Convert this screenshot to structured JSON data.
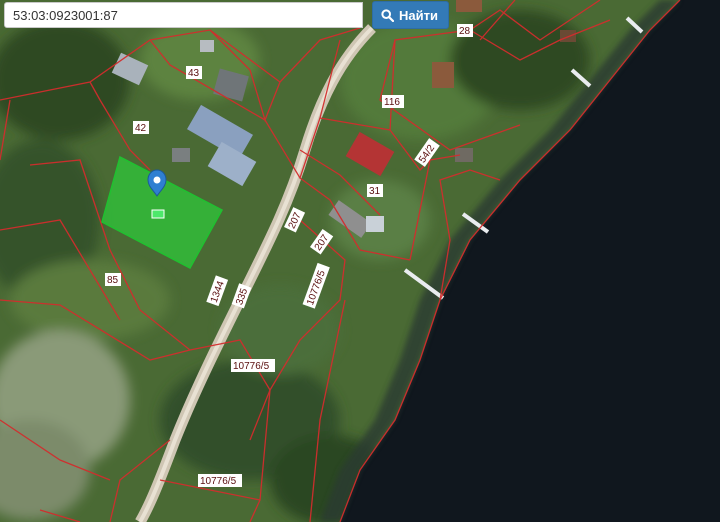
{
  "search": {
    "query": "53:03:0923001:87",
    "button_label": "Найти",
    "button_icon": "search-icon"
  },
  "map": {
    "type": "satellite",
    "parcel_outline_color": "#d22d2d",
    "selected_parcel_color": "#28dc3c",
    "marker_icon": "map-pin-icon",
    "marker_color": "#2f7fd1",
    "labels": {
      "l28": "28",
      "l43": "43",
      "l42": "42",
      "l116": "116",
      "l54_2": "54/2",
      "l31": "31",
      "l207a": "207",
      "l207b": "207",
      "l85": "85",
      "l1344": "1344",
      "l335": "335",
      "l10776_5a": "10776/5",
      "l10776_5b": "10776/5",
      "l10776_5c": "10776/5"
    }
  }
}
